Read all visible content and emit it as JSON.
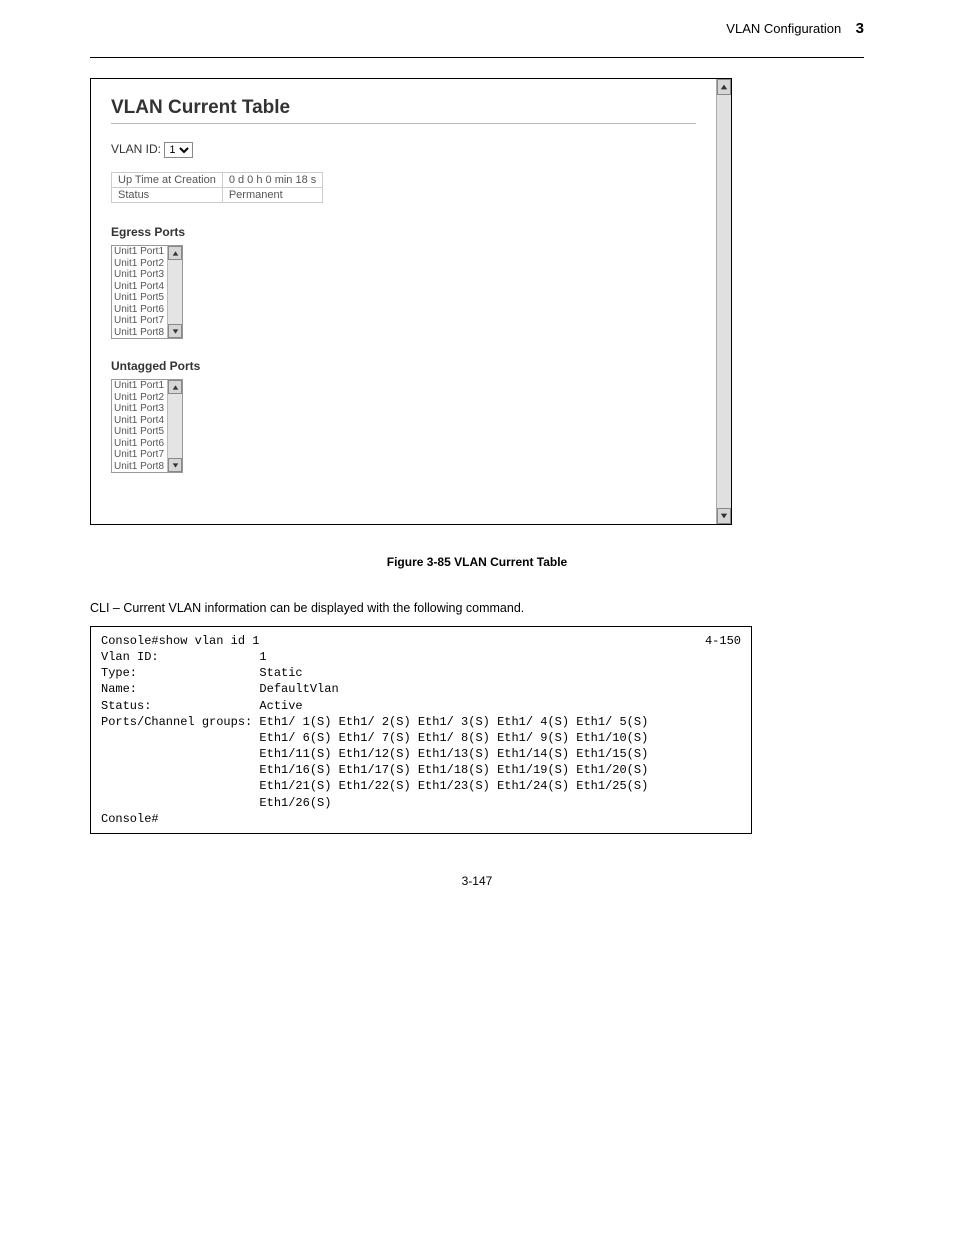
{
  "header": {
    "left": "",
    "right": "VLAN Configuration",
    "chapter": "3"
  },
  "webui": {
    "title": "VLAN Current Table",
    "vlan_id_label": "VLAN ID:",
    "vlan_id_value": "1",
    "meta": {
      "uptime_label": "Up Time at Creation",
      "uptime_value": "0 d 0 h 0 min 18 s",
      "status_label": "Status",
      "status_value": "Permanent"
    },
    "egress": {
      "label": "Egress Ports",
      "items": [
        "Unit1 Port1",
        "Unit1 Port2",
        "Unit1 Port3",
        "Unit1 Port4",
        "Unit1 Port5",
        "Unit1 Port6",
        "Unit1 Port7",
        "Unit1 Port8"
      ]
    },
    "untagged": {
      "label": "Untagged Ports",
      "items": [
        "Unit1 Port1",
        "Unit1 Port2",
        "Unit1 Port3",
        "Unit1 Port4",
        "Unit1 Port5",
        "Unit1 Port6",
        "Unit1 Port7",
        "Unit1 Port8"
      ]
    }
  },
  "figure_caption": "Figure 3-85   VLAN Current Table",
  "cli_intro": "CLI – Current VLAN information can be displayed with the following command.",
  "cli": {
    "page_ref": "4-150",
    "text": "Console#show vlan id 1\nVlan ID:              1\nType:                 Static\nName:                 DefaultVlan\nStatus:               Active\nPorts/Channel groups: Eth1/ 1(S) Eth1/ 2(S) Eth1/ 3(S) Eth1/ 4(S) Eth1/ 5(S)\n                      Eth1/ 6(S) Eth1/ 7(S) Eth1/ 8(S) Eth1/ 9(S) Eth1/10(S)\n                      Eth1/11(S) Eth1/12(S) Eth1/13(S) Eth1/14(S) Eth1/15(S)\n                      Eth1/16(S) Eth1/17(S) Eth1/18(S) Eth1/19(S) Eth1/20(S)\n                      Eth1/21(S) Eth1/22(S) Eth1/23(S) Eth1/24(S) Eth1/25(S)\n                      Eth1/26(S)\nConsole#"
  },
  "footer": "3-147"
}
